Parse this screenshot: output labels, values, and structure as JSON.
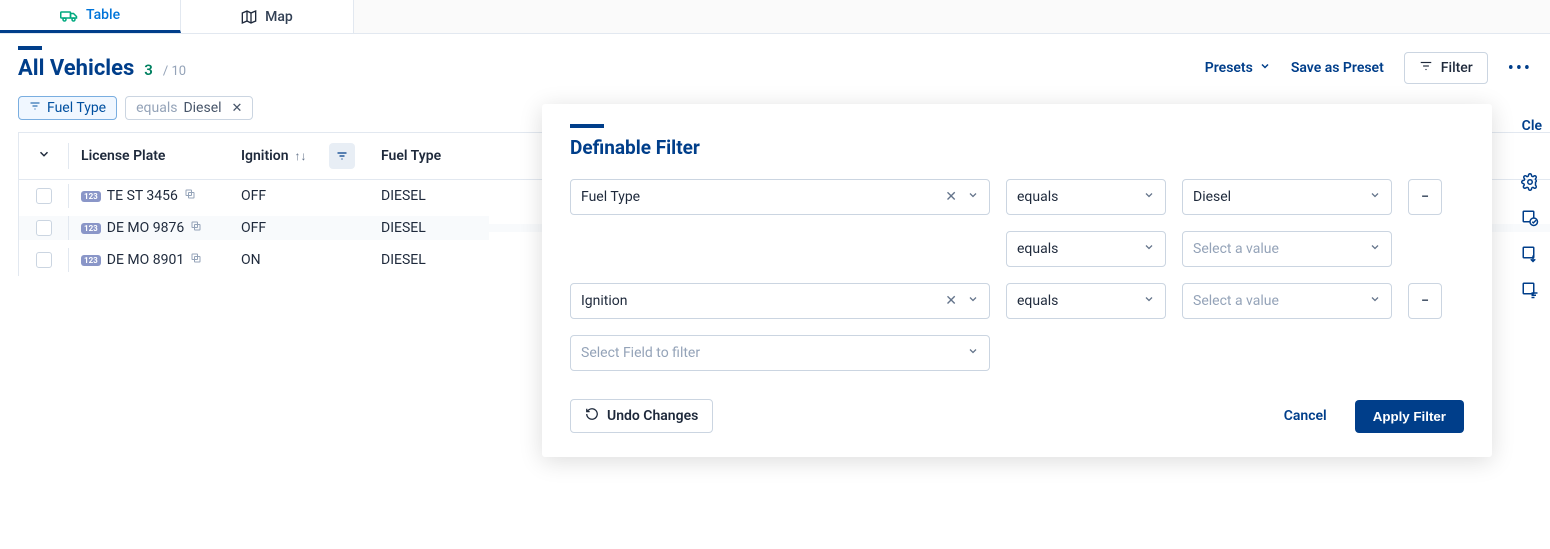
{
  "tabs": {
    "table": "Table",
    "map": "Map"
  },
  "header": {
    "title": "All Vehicles",
    "count": "3",
    "total": "/ 10",
    "presets": "Presets",
    "save_preset": "Save as Preset",
    "filter": "Filter",
    "clear": "Cle"
  },
  "chips": {
    "fuel_type": "Fuel Type",
    "equals_diesel_prefix": "equals ",
    "equals_diesel_value": "Diesel"
  },
  "columns": {
    "license": "License Plate",
    "ignition": "Ignition",
    "fuel": "Fuel Type"
  },
  "rows": [
    {
      "plate": "TE ST 3456",
      "ignition": "OFF",
      "fuel": "DIESEL"
    },
    {
      "plate": "DE MO 9876",
      "ignition": "OFF",
      "fuel": "DIESEL"
    },
    {
      "plate": "DE MO 8901",
      "ignition": "ON",
      "fuel": "DIESEL"
    }
  ],
  "panel": {
    "title": "Definable Filter",
    "rows": [
      {
        "field": "Fuel Type",
        "op": "equals",
        "value": "Diesel"
      },
      {
        "field": "",
        "op": "equals",
        "value": ""
      },
      {
        "field": "Ignition",
        "op": "equals",
        "value": ""
      }
    ],
    "placeholders": {
      "value": "Select a value",
      "field": "Select Field to filter"
    },
    "undo": "Undo Changes",
    "cancel": "Cancel",
    "apply": "Apply Filter"
  },
  "plate_badge": "123"
}
